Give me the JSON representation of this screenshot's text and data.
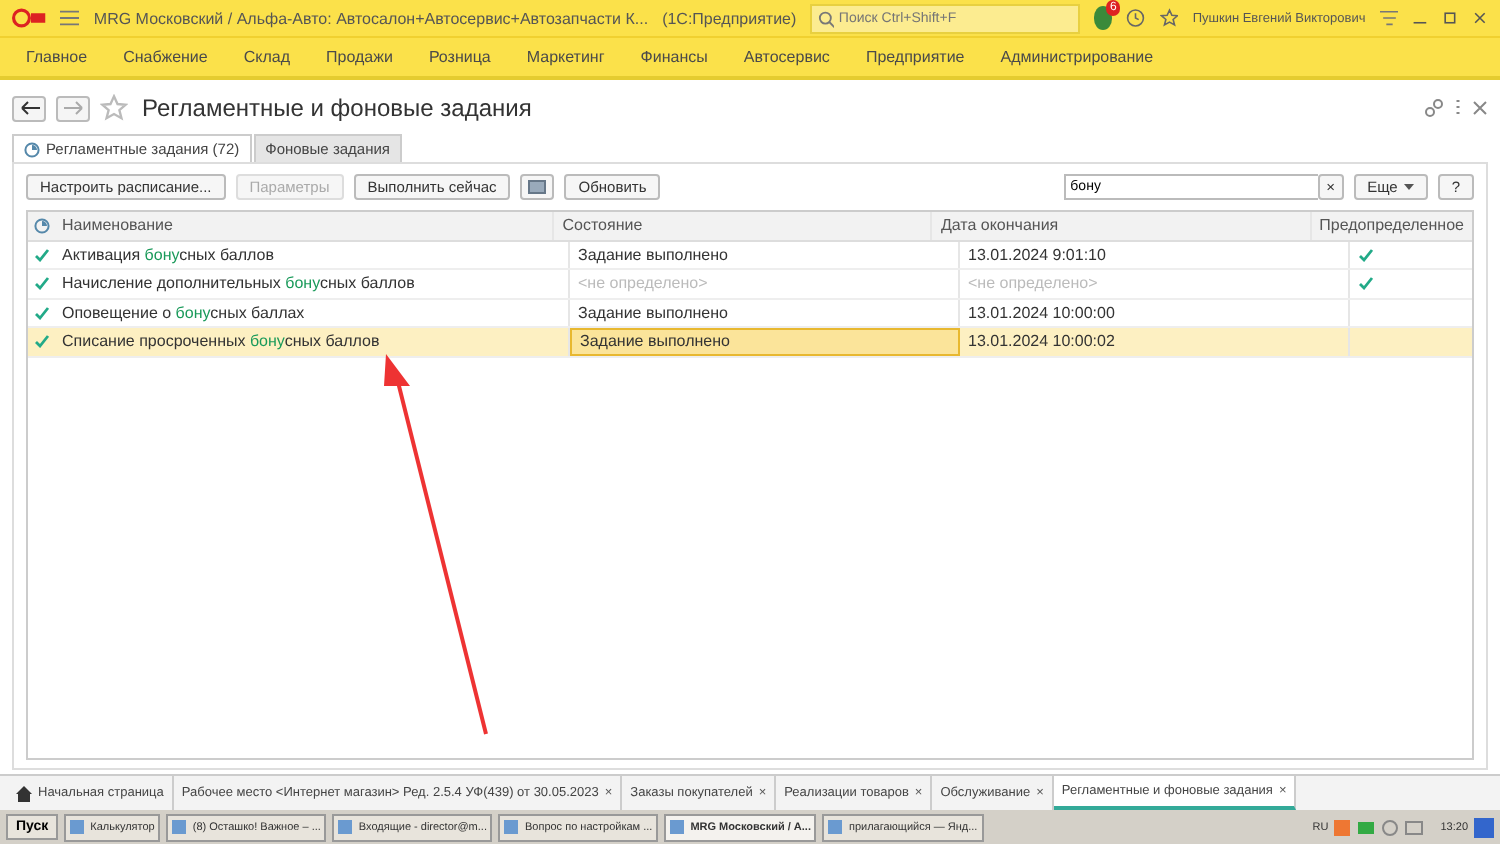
{
  "title_bar": {
    "title": "MRG Московский / Альфа-Авто: Автосалон+Автосервис+Автозапчасти К...",
    "app": "(1С:Предприятие)",
    "search_placeholder": "Поиск Ctrl+Shift+F",
    "notification_count": "6",
    "user": "Пушкин Евгений Викторович"
  },
  "menu": [
    {
      "label": "Главное"
    },
    {
      "label": "Снабжение"
    },
    {
      "label": "Склад"
    },
    {
      "label": "Продажи"
    },
    {
      "label": "Розница"
    },
    {
      "label": "Маркетинг"
    },
    {
      "label": "Финансы"
    },
    {
      "label": "Автосервис"
    },
    {
      "label": "Предприятие"
    },
    {
      "label": "Администрирование"
    }
  ],
  "page_title": "Регламентные и фоновые задания",
  "tabs": [
    {
      "label": "Регламентные задания (72)",
      "selected": true
    },
    {
      "label": "Фоновые задания",
      "selected": false
    }
  ],
  "toolbar": [
    {
      "label": "Настроить расписание...",
      "disabled": false
    },
    {
      "label": "Параметры",
      "disabled": true
    },
    {
      "label": "Выполнить сейчас",
      "disabled": false
    }
  ],
  "refresh_button": "Обновить",
  "search_value": "бону",
  "clear_button": "×",
  "more_button": "Еще",
  "help_button": "?",
  "table": {
    "columns": [
      "Наименование",
      "Состояние",
      "Дата окончания",
      "Предопределенное"
    ],
    "rows": [
      {
        "name": {
          "before": "Активация ",
          "match": "бону",
          "after": "сных баллов"
        },
        "state": "Задание выполнено",
        "state_undefined": false,
        "date": "13.01.2024 9:01:10",
        "date_undefined": false,
        "predefined": true,
        "selected": false
      },
      {
        "name": {
          "before": "Начисление дополнительных ",
          "match": "бону",
          "after": "сных баллов"
        },
        "state": "<не определено>",
        "state_undefined": true,
        "date": "<не определено>",
        "date_undefined": true,
        "predefined": true,
        "selected": false
      },
      {
        "name": {
          "before": "Оповещение о ",
          "match": "бону",
          "after": "сных баллах"
        },
        "state": "Задание выполнено",
        "state_undefined": false,
        "date": "13.01.2024 10:00:00",
        "date_undefined": false,
        "predefined": false,
        "selected": false
      },
      {
        "name": {
          "before": "Списание просроченных ",
          "match": "бону",
          "after": "сных баллов"
        },
        "state": "Задание выполнено",
        "state_undefined": false,
        "date": "13.01.2024 10:00:02",
        "date_undefined": false,
        "predefined": false,
        "selected": true
      }
    ]
  },
  "open_tabs": [
    {
      "label": "Начальная страница",
      "home": true,
      "closable": false,
      "selected": false
    },
    {
      "label": "Рабочее место <Интернет магазин> Ред. 2.5.4 УФ(439) от 30.05.2023",
      "home": false,
      "closable": true,
      "selected": false
    },
    {
      "label": "Заказы покупателей",
      "home": false,
      "closable": true,
      "selected": false
    },
    {
      "label": "Реализации товаров",
      "home": false,
      "closable": true,
      "selected": false
    },
    {
      "label": "Обслуживание",
      "home": false,
      "closable": true,
      "selected": false
    },
    {
      "label": "Регламентные и фоновые задания",
      "home": false,
      "closable": true,
      "selected": true
    }
  ],
  "close_mark": "×",
  "taskbar": {
    "start": "Пуск",
    "items": [
      {
        "label": "Калькулятор",
        "selected": false
      },
      {
        "label": "(8) Осташко! Важное – ...",
        "selected": false
      },
      {
        "label": "Входящие - director@m...",
        "selected": false
      },
      {
        "label": "Вопрос по настройкам ...",
        "selected": false
      },
      {
        "label": "MRG Московский / А...",
        "selected": true
      },
      {
        "label": "прилагающийся — Янд...",
        "selected": false
      }
    ],
    "lang": "RU",
    "time": "13:20"
  }
}
